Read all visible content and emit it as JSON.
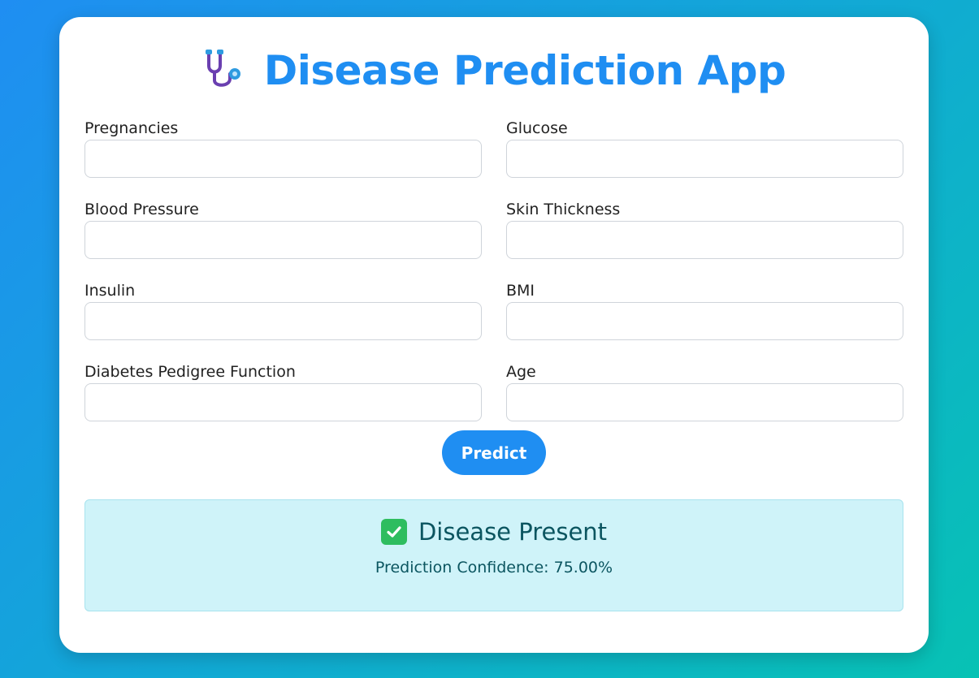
{
  "app": {
    "title": "Disease Prediction App",
    "title_icon": "stethoscope-icon",
    "accent_color": "#1f8ef2"
  },
  "form": {
    "fields": [
      {
        "label": "Pregnancies",
        "value": "",
        "placeholder": ""
      },
      {
        "label": "Glucose",
        "value": "",
        "placeholder": ""
      },
      {
        "label": "Blood Pressure",
        "value": "",
        "placeholder": ""
      },
      {
        "label": "Skin Thickness",
        "value": "",
        "placeholder": ""
      },
      {
        "label": "Insulin",
        "value": "",
        "placeholder": ""
      },
      {
        "label": "BMI",
        "value": "",
        "placeholder": ""
      },
      {
        "label": "Diabetes Pedigree Function",
        "value": "",
        "placeholder": ""
      },
      {
        "label": "Age",
        "value": "",
        "placeholder": ""
      }
    ],
    "submit_label": "Predict"
  },
  "result": {
    "icon": "check-mark-icon",
    "heading": "Disease Present",
    "confidence_text": "Prediction Confidence: 75.00%",
    "background_color": "#cff3f9",
    "text_color": "#0b5560"
  }
}
